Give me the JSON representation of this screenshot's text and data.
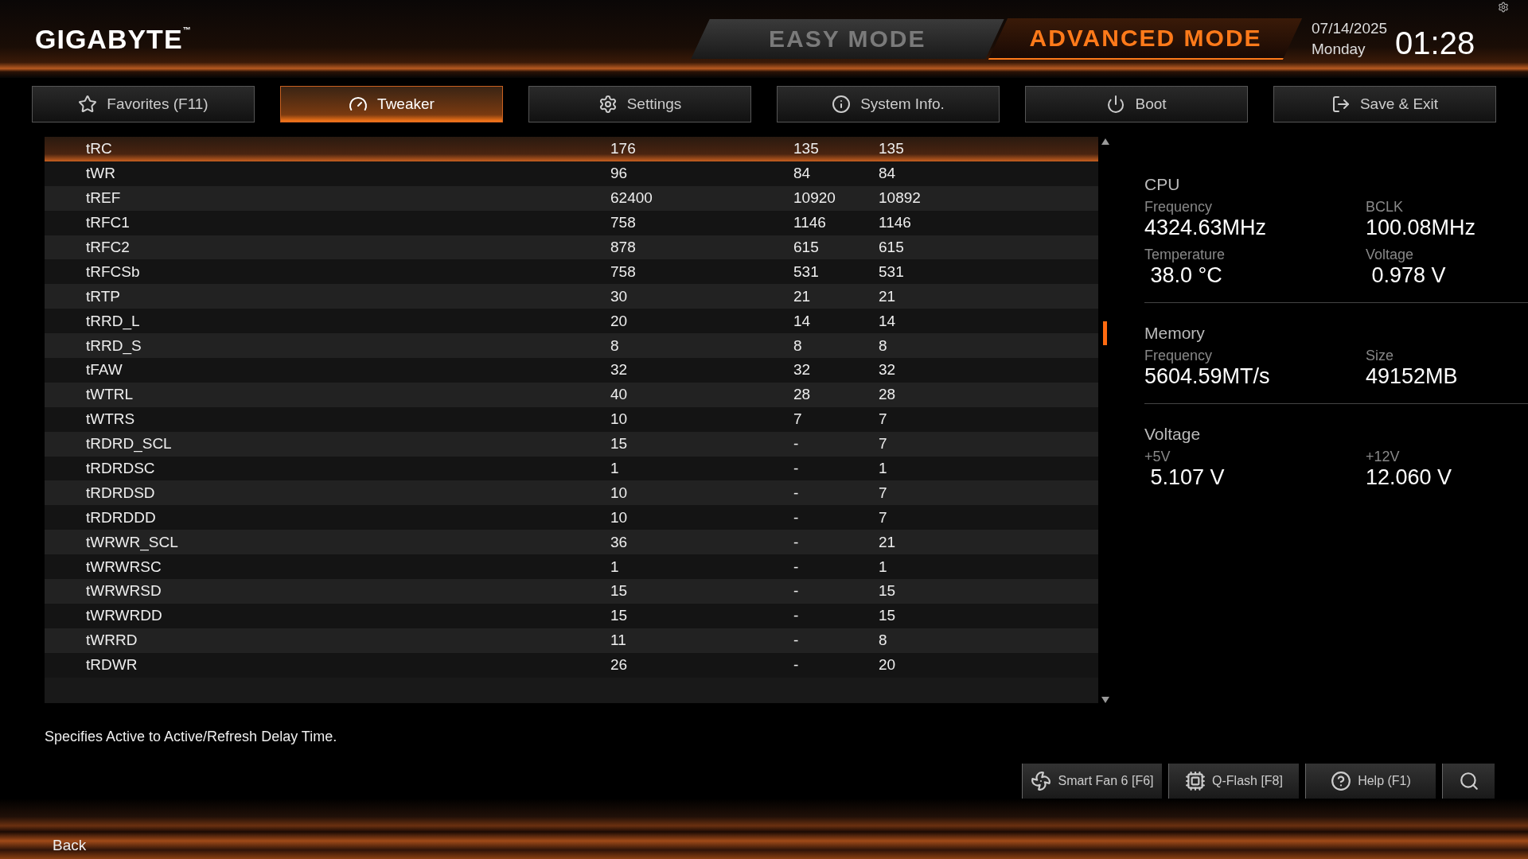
{
  "logo": {
    "text": "GIGABYTE",
    "mark": "™"
  },
  "modes": [
    {
      "label": "EASY MODE",
      "selected": false
    },
    {
      "label": "ADVANCED MODE",
      "selected": true
    }
  ],
  "datetime": {
    "date": "07/14/2025",
    "day": "Monday",
    "time": "01:28"
  },
  "tabs": [
    {
      "label": "Favorites (F11)",
      "kind": "favorites",
      "selected": false
    },
    {
      "label": "Tweaker",
      "kind": "tweaker",
      "selected": true
    },
    {
      "label": "Settings",
      "kind": "settings",
      "selected": false
    },
    {
      "label": "System Info.",
      "kind": "info",
      "selected": false
    },
    {
      "label": "Boot",
      "kind": "boot",
      "selected": false
    },
    {
      "label": "Save & Exit",
      "kind": "exit",
      "selected": false
    }
  ],
  "table": {
    "rows": [
      {
        "name": "tRC",
        "values": [
          "176",
          "135",
          "135"
        ],
        "selected": true
      },
      {
        "name": "tWR",
        "values": [
          "96",
          "84",
          "84"
        ],
        "selected": false
      },
      {
        "name": "tREF",
        "values": [
          "62400",
          "10920",
          "10892"
        ],
        "selected": false
      },
      {
        "name": "tRFC1",
        "values": [
          "758",
          "1146",
          "1146"
        ],
        "selected": false
      },
      {
        "name": "tRFC2",
        "values": [
          "878",
          "615",
          "615"
        ],
        "selected": false
      },
      {
        "name": "tRFCSb",
        "values": [
          "758",
          "531",
          "531"
        ],
        "selected": false
      },
      {
        "name": "tRTP",
        "values": [
          "30",
          "21",
          "21"
        ],
        "selected": false
      },
      {
        "name": "tRRD_L",
        "values": [
          "20",
          "14",
          "14"
        ],
        "selected": false
      },
      {
        "name": "tRRD_S",
        "values": [
          "8",
          "8",
          "8"
        ],
        "selected": false
      },
      {
        "name": "tFAW",
        "values": [
          "32",
          "32",
          "32"
        ],
        "selected": false
      },
      {
        "name": "tWTRL",
        "values": [
          "40",
          "28",
          "28"
        ],
        "selected": false
      },
      {
        "name": "tWTRS",
        "values": [
          "10",
          "7",
          "7"
        ],
        "selected": false
      },
      {
        "name": "tRDRD_SCL",
        "values": [
          "15",
          "-",
          "7"
        ],
        "selected": false
      },
      {
        "name": "tRDRDSC",
        "values": [
          "1",
          "-",
          "1"
        ],
        "selected": false
      },
      {
        "name": "tRDRDSD",
        "values": [
          "10",
          "-",
          "7"
        ],
        "selected": false
      },
      {
        "name": "tRDRDDD",
        "values": [
          "10",
          "-",
          "7"
        ],
        "selected": false
      },
      {
        "name": "tWRWR_SCL",
        "values": [
          "36",
          "-",
          "21"
        ],
        "selected": false
      },
      {
        "name": "tWRWRSC",
        "values": [
          "1",
          "-",
          "1"
        ],
        "selected": false
      },
      {
        "name": "tWRWRSD",
        "values": [
          "15",
          "-",
          "15"
        ],
        "selected": false
      },
      {
        "name": "tWRWRDD",
        "values": [
          "15",
          "-",
          "15"
        ],
        "selected": false
      },
      {
        "name": "tWRRD",
        "values": [
          "11",
          "-",
          "8"
        ],
        "selected": false
      },
      {
        "name": "tRDWR",
        "values": [
          "26",
          "-",
          "20"
        ],
        "selected": false
      }
    ]
  },
  "description": "Specifies Active to Active/Refresh Delay Time.",
  "monitor": [
    {
      "title": "CPU",
      "items": [
        {
          "label": "Frequency",
          "value": "4324.63MHz"
        },
        {
          "label": "BCLK",
          "value": "100.08MHz"
        },
        {
          "label": "Temperature",
          "value": " 38.0 °C"
        },
        {
          "label": "Voltage",
          "value": " 0.978 V"
        }
      ]
    },
    {
      "title": "Memory",
      "items": [
        {
          "label": "Frequency",
          "value": "5604.59MT/s"
        },
        {
          "label": "Size",
          "value": "49152MB"
        }
      ]
    },
    {
      "title": "Voltage",
      "items": [
        {
          "label": "+5V",
          "value": " 5.107 V"
        },
        {
          "label": "+12V",
          "value": "12.060 V"
        }
      ]
    }
  ],
  "tools": [
    {
      "label": "Smart Fan 6 [F6]",
      "kind": "fan"
    },
    {
      "label": "Q-Flash [F8]",
      "kind": "chip"
    },
    {
      "label": "Help (F1)",
      "kind": "help"
    },
    {
      "kind": "search"
    }
  ],
  "back": "Back"
}
